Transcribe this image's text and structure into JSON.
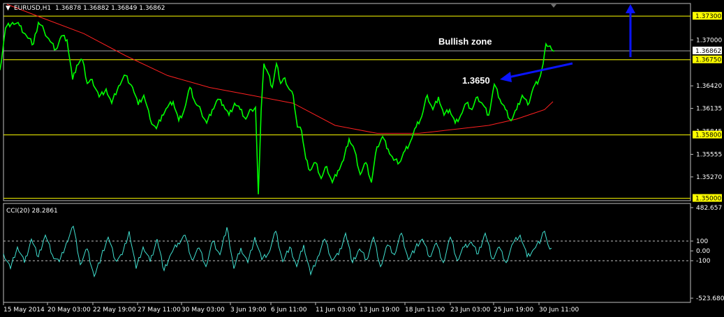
{
  "header": {
    "arrow": "▼",
    "symbol": "EURUSD,H1",
    "ohlc": "1.36878 1.36882 1.36849 1.36862"
  },
  "price_axis": {
    "ticks": [
      "1.37000",
      "1.36420",
      "1.36135",
      "1.35555",
      "1.35270"
    ],
    "current_price": "1.36862",
    "level_tags": [
      "1.37300",
      "1.36750",
      "1.35800",
      "1.35000"
    ],
    "overlapped_tick": "1.35845"
  },
  "cci": {
    "label": "CCI(20) 28.2861",
    "ticks": [
      "482.657",
      "100",
      "0.00",
      "-100",
      "-523.6804"
    ]
  },
  "time_axis": {
    "labels": [
      "15 May 2014",
      "20 May 03:00",
      "22 May 19:00",
      "27 May 11:00",
      "30 May 03:00",
      "3 Jun 19:00",
      "6 Jun 11:00",
      "11 Jun 03:00",
      "13 Jun 19:00",
      "18 Jun 11:00",
      "23 Jun 03:00",
      "25 Jun 19:00",
      "30 Jun 11:00"
    ]
  },
  "annotations": {
    "bullish_zone": "Bullish zone",
    "level": "1.3650"
  },
  "colors": {
    "price": "#00ff00",
    "ma": "#ff2020",
    "level": "#ffff00",
    "arrow": "#0a14ff",
    "cci": "#40e0d0",
    "grid": "#c0c0c0"
  },
  "chart_data": {
    "type": "line",
    "series": [
      {
        "name": "EURUSD,H1",
        "x": [
          0,
          8,
          18,
          28,
          38,
          48,
          55,
          63,
          72,
          80,
          88,
          96,
          104,
          110,
          118,
          125,
          132,
          142,
          152,
          160,
          170,
          180,
          190,
          198,
          206,
          215,
          224,
          232,
          240,
          248,
          256,
          264,
          272,
          280,
          288,
          296,
          304,
          312,
          320,
          328,
          336,
          344,
          352,
          360,
          366,
          370,
          374,
          378,
          384,
          390,
          396,
          402,
          408,
          414,
          420,
          426,
          432,
          438,
          444,
          452,
          460,
          468,
          476,
          484,
          492,
          500,
          508,
          516,
          524,
          532,
          540,
          548,
          556,
          564,
          572,
          580,
          588,
          596,
          604,
          612,
          620,
          628,
          636,
          644,
          652,
          660,
          668,
          676,
          684,
          692,
          700,
          708,
          716,
          724,
          732,
          740,
          748,
          756,
          764,
          772,
          778,
          782,
          786,
          790,
          794
        ],
        "y": [
          1.3662,
          1.3715,
          1.3722,
          1.3718,
          1.3705,
          1.3695,
          1.3722,
          1.3712,
          1.3698,
          1.3688,
          1.3705,
          1.37,
          1.365,
          1.3668,
          1.3675,
          1.3645,
          1.365,
          1.3628,
          1.3638,
          1.362,
          1.3642,
          1.3655,
          1.364,
          1.3618,
          1.363,
          1.36,
          1.3588,
          1.3605,
          1.3615,
          1.3622,
          1.3598,
          1.3612,
          1.364,
          1.362,
          1.361,
          1.3595,
          1.3612,
          1.3625,
          1.3618,
          1.3605,
          1.362,
          1.3612,
          1.36,
          1.3612,
          1.3615,
          1.3505,
          1.361,
          1.367,
          1.3658,
          1.364,
          1.367,
          1.3645,
          1.3652,
          1.3638,
          1.363,
          1.359,
          1.3585,
          1.355,
          1.3535,
          1.3545,
          1.3525,
          1.354,
          1.352,
          1.3535,
          1.3548,
          1.3575,
          1.356,
          1.353,
          1.3545,
          1.352,
          1.3565,
          1.3578,
          1.3562,
          1.3548,
          1.3545,
          1.356,
          1.3572,
          1.359,
          1.3603,
          1.363,
          1.3612,
          1.3628,
          1.3605,
          1.3612,
          1.3595,
          1.3605,
          1.362,
          1.3612,
          1.3628,
          1.3618,
          1.3605,
          1.3644,
          1.3625,
          1.3612,
          1.3598,
          1.3612,
          1.363,
          1.3618,
          1.364,
          1.365,
          1.367,
          1.3695,
          1.3692,
          1.3688,
          1.3686
        ]
      },
      {
        "name": "MA",
        "x": [
          10,
          60,
          120,
          180,
          240,
          300,
          360,
          420,
          480,
          540,
          600,
          660,
          700,
          740,
          780,
          792
        ],
        "y": [
          1.3745,
          1.3728,
          1.3708,
          1.368,
          1.3655,
          1.364,
          1.363,
          1.362,
          1.3592,
          1.3582,
          1.3582,
          1.3588,
          1.3592,
          1.36,
          1.3612,
          1.3622
        ]
      },
      {
        "name": "CCI(20)",
        "x": [
          5,
          15,
          25,
          35,
          45,
          55,
          65,
          75,
          85,
          95,
          105,
          115,
          125,
          135,
          145,
          155,
          165,
          175,
          185,
          195,
          205,
          215,
          225,
          235,
          245,
          255,
          265,
          275,
          285,
          295,
          305,
          315,
          325,
          335,
          345,
          355,
          365,
          375,
          385,
          395,
          405,
          415,
          425,
          435,
          445,
          455,
          465,
          475,
          485,
          495,
          505,
          515,
          525,
          535,
          545,
          555,
          565,
          575,
          585,
          595,
          605,
          615,
          625,
          635,
          645,
          655,
          665,
          675,
          685,
          695,
          705,
          715,
          725,
          735,
          745,
          755,
          765,
          775,
          780,
          785,
          790
        ],
        "y": [
          -30,
          -180,
          40,
          -120,
          120,
          -60,
          160,
          -40,
          -110,
          80,
          250,
          -140,
          20,
          -260,
          -60,
          140,
          -90,
          -40,
          200,
          -180,
          40,
          -110,
          120,
          -200,
          -30,
          80,
          160,
          -90,
          30,
          -160,
          100,
          -40,
          240,
          -180,
          30,
          -120,
          140,
          -90,
          -20,
          200,
          -110,
          40,
          -160,
          60,
          -240,
          -60,
          120,
          -90,
          -40,
          180,
          -120,
          20,
          -90,
          140,
          -160,
          60,
          -40,
          180,
          -90,
          30,
          120,
          -60,
          80,
          -120,
          140,
          -100,
          40,
          90,
          -30,
          180,
          -80,
          40,
          -120,
          80,
          160,
          -60,
          20,
          120,
          200,
          60,
          28
        ]
      }
    ],
    "y_ticks": [
      "1.37000",
      "1.36420",
      "1.36135",
      "1.35555",
      "1.35270"
    ],
    "horizontal_levels": [
      1.373,
      1.3675,
      1.358,
      1.35
    ],
    "current_price": 1.36862,
    "ylim": [
      1.3497,
      1.3746
    ],
    "cci_range": [
      -523.6804,
      482.657
    ],
    "cci_levels": [
      100,
      0,
      -100
    ],
    "x_tick_labels": [
      "15 May 2014",
      "20 May 03:00",
      "22 May 19:00",
      "27 May 11:00",
      "30 May 03:00",
      "3 Jun 19:00",
      "6 Jun 11:00",
      "11 Jun 03:00",
      "13 Jun 19:00",
      "18 Jun 11:00",
      "23 Jun 03:00",
      "25 Jun 19:00",
      "30 Jun 11:00"
    ],
    "annotations": [
      "Bullish zone",
      "1.3650"
    ],
    "grid": false
  }
}
